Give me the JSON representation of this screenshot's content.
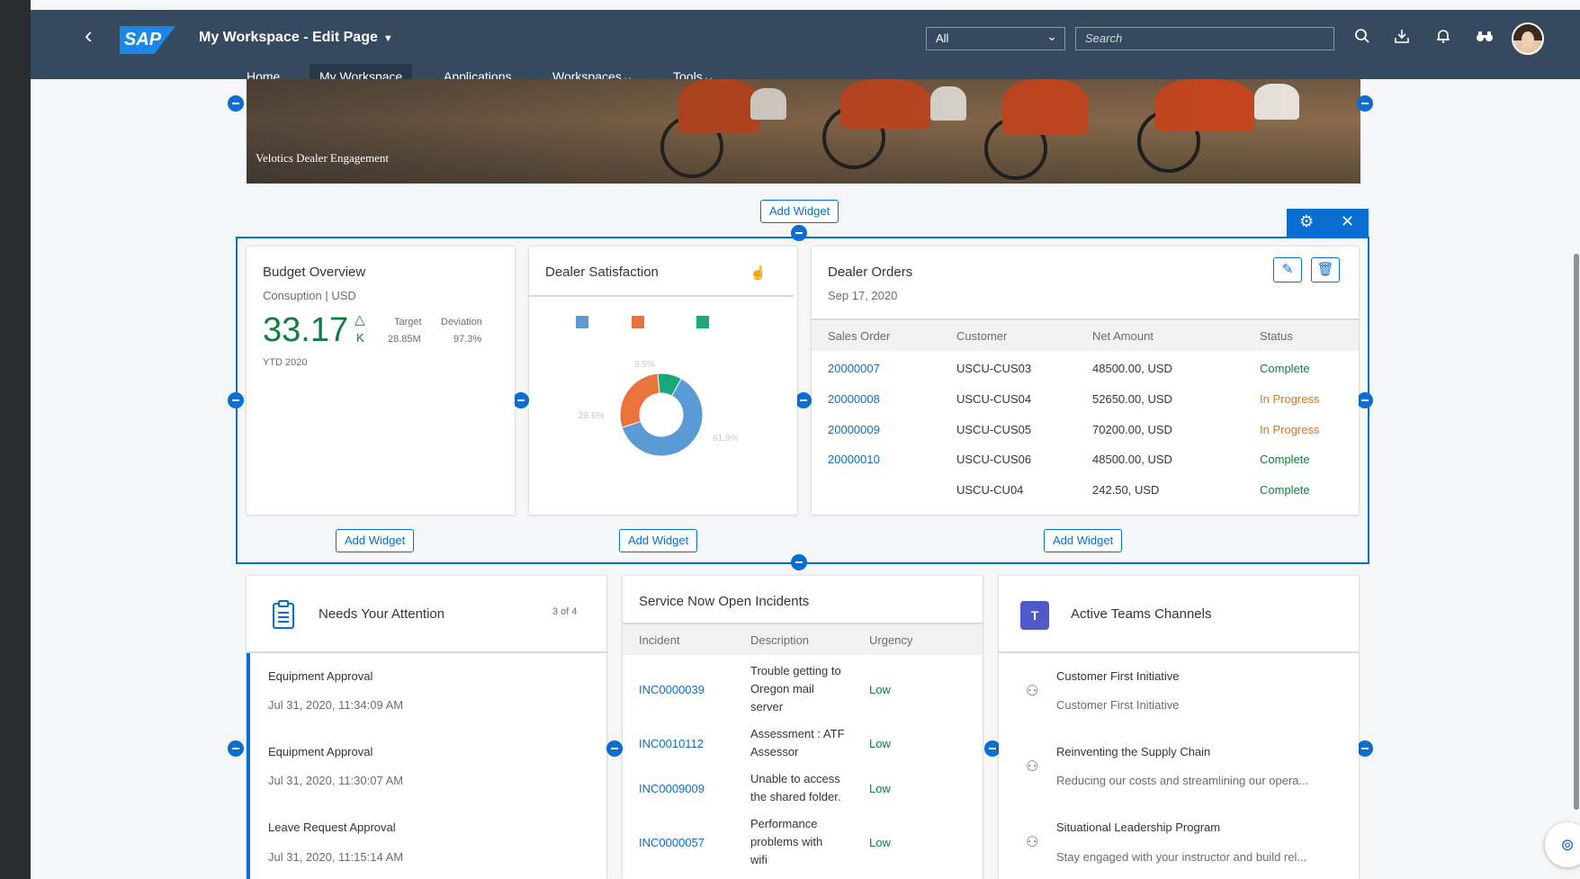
{
  "header": {
    "app_title": "My Workspace - Edit Page",
    "logo_text": "SAP",
    "scope_value": "All",
    "search_placeholder": "Search",
    "nav": [
      "Home",
      "My Workspace",
      "Applications",
      "Workspaces",
      "Tools"
    ]
  },
  "banner": {
    "title": "Velotics Dealer Engagement"
  },
  "edit": {
    "add_widget_label": "Add Widget"
  },
  "budget": {
    "title": "Budget Overview",
    "subtitle": "Consuption | USD",
    "kpi_value": "33.17",
    "kpi_unit": "K",
    "target_label": "Target",
    "target_value": "28.85M",
    "deviation_label": "Deviation",
    "deviation_value": "97.3%",
    "period": "YTD 2020"
  },
  "satisfaction": {
    "title": "Dealer Satisfaction",
    "colors": [
      "#5b9bd5",
      "#e8743b",
      "#19a979"
    ],
    "chart_data": {
      "type": "pie",
      "values": [
        61.9,
        28.6,
        9.5
      ],
      "labels": [
        "61.9%",
        "28.6%",
        "9.5%"
      ]
    }
  },
  "orders": {
    "title": "Dealer Orders",
    "date": "Sep 17, 2020",
    "columns": [
      "Sales Order",
      "Customer",
      "Net Amount",
      "Status"
    ],
    "rows": [
      {
        "order": "20000007",
        "customer": "USCU-CUS03",
        "amount": "48500.00, USD",
        "status": "Complete"
      },
      {
        "order": "20000008",
        "customer": "USCU-CUS04",
        "amount": "52650.00, USD",
        "status": "In Progress"
      },
      {
        "order": "20000009",
        "customer": "USCU-CUS05",
        "amount": "70200.00, USD",
        "status": "In Progress"
      },
      {
        "order": "20000010",
        "customer": "USCU-CUS06",
        "amount": "48500.00, USD",
        "status": "Complete"
      },
      {
        "order": "",
        "customer": "USCU-CU04",
        "amount": "242.50, USD",
        "status": "Complete"
      }
    ]
  },
  "attention": {
    "title": "Needs Your Attention",
    "count": "3 of 4",
    "items": [
      {
        "title": "Equipment Approval",
        "time": "Jul 31, 2020, 11:34:09 AM"
      },
      {
        "title": "Equipment Approval",
        "time": "Jul 31, 2020, 11:30:07 AM"
      },
      {
        "title": "Leave Request Approval",
        "time": "Jul 31, 2020, 11:15:14 AM"
      }
    ]
  },
  "incidents": {
    "title": "Service Now Open Incidents",
    "columns": [
      "Incident",
      "Description",
      "Urgency"
    ],
    "rows": [
      {
        "id": "INC0000039",
        "desc": [
          "Trouble getting to",
          "Oregon mail",
          "server"
        ],
        "urgency": "Low"
      },
      {
        "id": "INC0010112",
        "desc": [
          "Assessment : ATF",
          "Assessor"
        ],
        "urgency": "Low"
      },
      {
        "id": "INC0009009",
        "desc": [
          "Unable to access",
          "the shared folder."
        ],
        "urgency": "Low"
      },
      {
        "id": "INC0000057",
        "desc": [
          "Performance",
          "problems with",
          "wifi"
        ],
        "urgency": "Low"
      }
    ]
  },
  "teams": {
    "title": "Active Teams Channels",
    "items": [
      {
        "title": "Customer First Initiative",
        "desc": "Customer First Initiative"
      },
      {
        "title": "Reinventing the Supply Chain",
        "desc": "Reducing our costs and streamlining our opera..."
      },
      {
        "title": "Situational Leadership Program",
        "desc": "Stay engaged with your instructor and build rel..."
      }
    ]
  }
}
